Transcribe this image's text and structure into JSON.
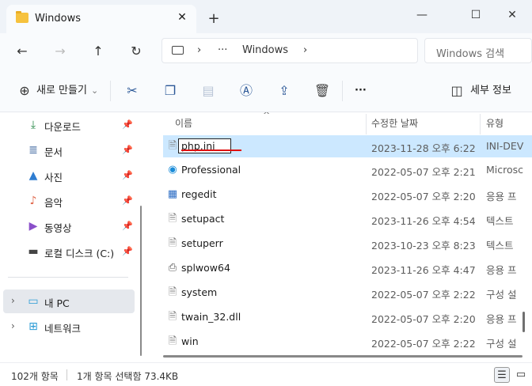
{
  "window": {
    "tab_title": "Windows",
    "tab_close": "✕",
    "new_tab": "+",
    "minimize": "—",
    "maximize": "☐",
    "close": "✕"
  },
  "address_bar": {
    "back": "←",
    "forward": "→",
    "up": "↑",
    "refresh": "↻",
    "chevron1": "›",
    "ellipsis": "···",
    "path_segment": "Windows",
    "chevron2": "›",
    "search_placeholder": "Windows 검색"
  },
  "toolbar": {
    "new_label": "새로 만들기",
    "new_chevron": "⌄",
    "more": "···",
    "details_label": "세부 정보"
  },
  "sidebar": {
    "items": [
      {
        "label": "다운로드",
        "icon": "download-icon",
        "glyph": "⤓",
        "color": "#2a8a4a",
        "pin": "📌"
      },
      {
        "label": "문서",
        "icon": "document-icon",
        "glyph": "≣",
        "color": "#4a6fa5",
        "pin": "📌"
      },
      {
        "label": "사진",
        "icon": "picture-icon",
        "glyph": "▲",
        "color": "#2f7dd1",
        "pin": "📌"
      },
      {
        "label": "음악",
        "icon": "music-icon",
        "glyph": "♪",
        "color": "#e0664a",
        "pin": "📌"
      },
      {
        "label": "동영상",
        "icon": "video-icon",
        "glyph": "▶",
        "color": "#8a4fc9",
        "pin": "📌"
      },
      {
        "label": "로컬 디스크 (C:)",
        "icon": "drive-icon",
        "glyph": "▬",
        "color": "#444444",
        "pin": "📌"
      }
    ],
    "this_pc": {
      "label": "내 PC",
      "chevron": "›"
    },
    "network": {
      "label": "네트워크",
      "chevron": "›"
    }
  },
  "columns": {
    "name": "이름",
    "date": "수정한 날짜",
    "type": "유형",
    "sort_indicator": "^"
  },
  "files": [
    {
      "name": "php.ini",
      "date": "2023-11-28 오후 6:22",
      "type": "INI-DEV",
      "icon": "ini-file-icon",
      "glyph": "🗎",
      "selected": true
    },
    {
      "name": "Professional",
      "date": "2022-05-07 오후 2:21",
      "type": "Microsc",
      "icon": "edge-icon",
      "glyph": "◉"
    },
    {
      "name": "regedit",
      "date": "2022-05-07 오후 2:20",
      "type": "응용 프",
      "icon": "regedit-icon",
      "glyph": "▦"
    },
    {
      "name": "setupact",
      "date": "2023-11-26 오후 4:54",
      "type": "텍스트",
      "icon": "text-file-icon",
      "glyph": "🗎"
    },
    {
      "name": "setuperr",
      "date": "2023-10-23 오후 8:23",
      "type": "텍스트",
      "icon": "text-file-icon",
      "glyph": "🗎"
    },
    {
      "name": "splwow64",
      "date": "2023-11-26 오후 4:47",
      "type": "응용 프",
      "icon": "printer-icon",
      "glyph": "⎙"
    },
    {
      "name": "system",
      "date": "2022-05-07 오후 2:22",
      "type": "구성 설",
      "icon": "config-file-icon",
      "glyph": "🗎"
    },
    {
      "name": "twain_32.dll",
      "date": "2022-05-07 오후 2:20",
      "type": "응용 프",
      "icon": "dll-file-icon",
      "glyph": "🗎"
    },
    {
      "name": "win",
      "date": "2022-05-07 오후 2:22",
      "type": "구성 설",
      "icon": "config-file-icon",
      "glyph": "🗎"
    }
  ],
  "rename_value": "php.ini",
  "status": {
    "item_count": "102개 항목",
    "selection": "1개 항목 선택함 73.4KB"
  },
  "colors": {
    "selection": "#cce8ff",
    "accent_red": "#e01010"
  }
}
